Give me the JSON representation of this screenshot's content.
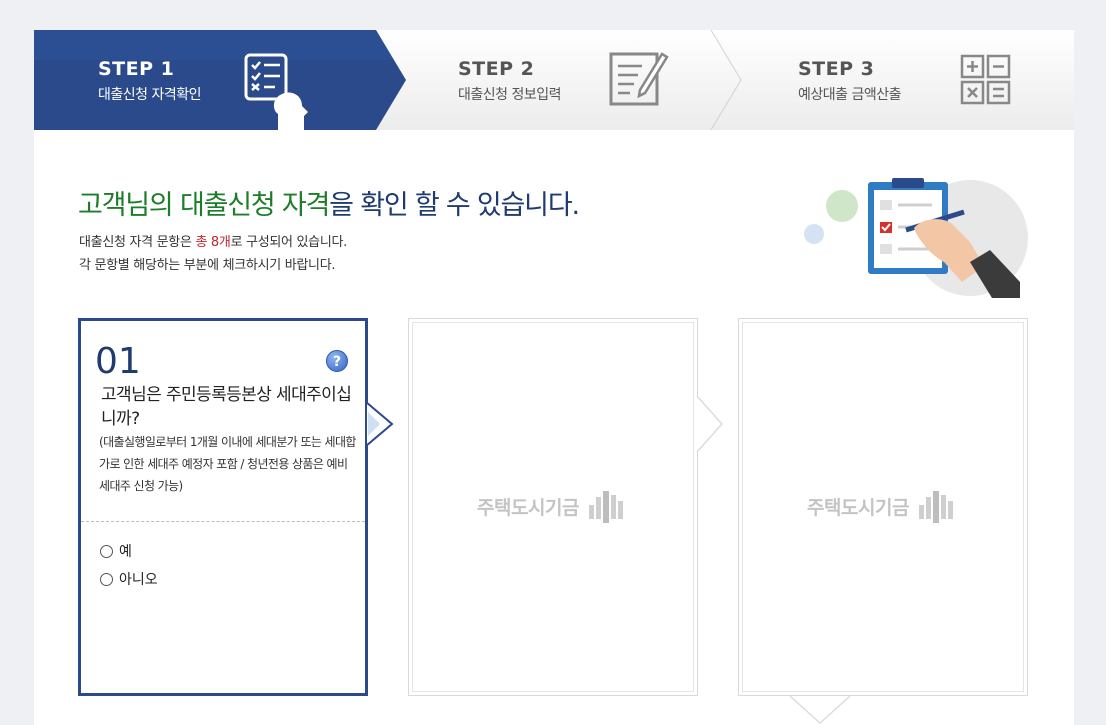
{
  "steps": [
    {
      "num": "STEP 1",
      "label": "대출신청 자격확인",
      "icon": "checklist-person-icon",
      "active": true
    },
    {
      "num": "STEP 2",
      "label": "대출신청 정보입력",
      "icon": "document-pencil-icon",
      "active": false
    },
    {
      "num": "STEP 3",
      "label": "예상대출 금액산출",
      "icon": "calculator-icon",
      "active": false
    }
  ],
  "headline": {
    "part1": "고객님의 대출신청 자격",
    "part2": "을 확인 할 수 있습니다."
  },
  "description": {
    "line1_pre": "대출신청 자격 문항은 ",
    "line1_highlight": "총 8개",
    "line1_post": "로 구성되어 있습니다.",
    "line2": "각 문항별 해당하는 부분에 체크하시기 바랍니다."
  },
  "question": {
    "number": "01",
    "help_label": "?",
    "title": "고객님은 주민등록등본상 세대주이십니까?",
    "note": "(대출실행일로부터 1개월 이내에 세대분가 또는 세대합가로 인한 세대주 예정자 포함 / 청년전용 상품은 예비세대주 신청 가능)",
    "options": [
      "예",
      "아니오"
    ]
  },
  "placeholder_card": {
    "watermark": "주택도시기금"
  },
  "colors": {
    "active_step": "#2b4a8b",
    "headline_green": "#1e7d2a",
    "headline_navy": "#1f3b70",
    "highlight_red": "#c0262f"
  }
}
